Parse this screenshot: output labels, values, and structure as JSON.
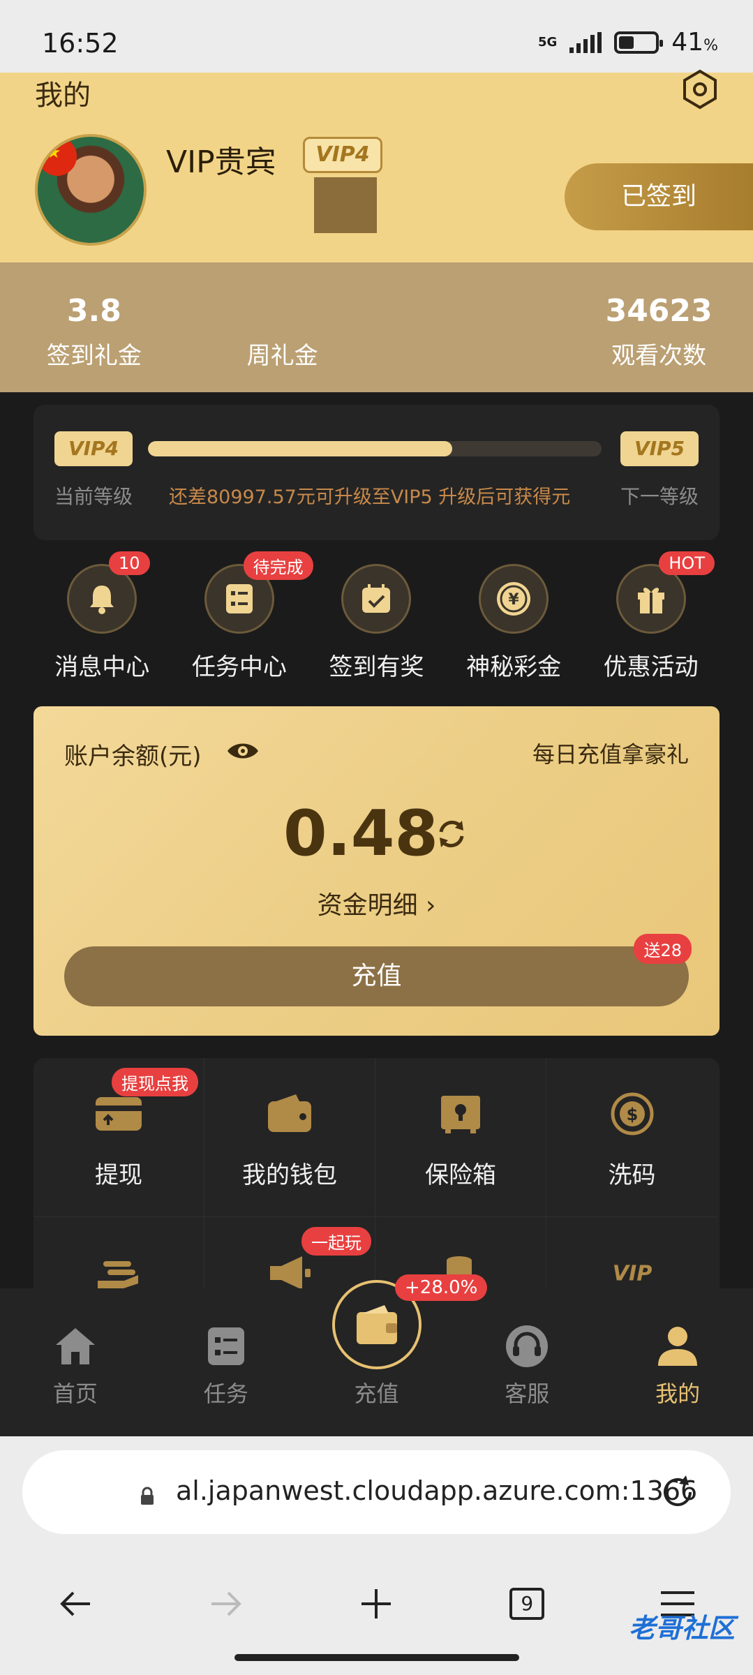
{
  "status_bar": {
    "time": "16:52",
    "network": "5G",
    "battery_value": "41",
    "battery_unit": "%",
    "battery_level": 0.41
  },
  "header": {
    "title": "我的",
    "vip_name": "VIP贵宾",
    "vip_badge": "VIP4",
    "signin_label": "已签到"
  },
  "stats": [
    {
      "value": "3.8",
      "label": "签到礼金"
    },
    {
      "value": "",
      "label": "周礼金"
    },
    {
      "value": "",
      "label": ""
    },
    {
      "value": "34623",
      "label": "观看次数"
    }
  ],
  "vip_progress": {
    "current_level": "VIP4",
    "next_level": "VIP5",
    "current_label": "当前等级",
    "next_label": "下一等级",
    "hint": "还差80997.57元可升级至VIP5 升级后可获得元",
    "progress": 0.67
  },
  "quick_icons": [
    {
      "label": "消息中心",
      "icon": "bell-icon",
      "badge": "10"
    },
    {
      "label": "任务中心",
      "icon": "task-list-icon",
      "badge": "待完成"
    },
    {
      "label": "签到有奖",
      "icon": "calendar-check-icon",
      "badge": ""
    },
    {
      "label": "神秘彩金",
      "icon": "yen-coin-icon",
      "badge": ""
    },
    {
      "label": "优惠活动",
      "icon": "gift-icon",
      "badge": "HOT"
    }
  ],
  "balance": {
    "label": "账户余额(元)",
    "promo": "每日充值拿豪礼",
    "amount": "0.48",
    "detail_link": "资金明细 ›",
    "recharge_label": "充值",
    "recharge_badge": "送28"
  },
  "services": [
    {
      "label": "提现",
      "icon": "card-withdraw-icon",
      "badge": "提现点我"
    },
    {
      "label": "我的钱包",
      "icon": "wallet-icon",
      "badge": ""
    },
    {
      "label": "保险箱",
      "icon": "safe-icon",
      "badge": ""
    },
    {
      "label": "洗码",
      "icon": "dollar-cycle-icon",
      "badge": ""
    },
    {
      "label": "",
      "icon": "hand-coins-icon",
      "badge": ""
    },
    {
      "label": "",
      "icon": "megaphone-icon",
      "badge": "一起玩"
    },
    {
      "label": "",
      "icon": "coins-stack-icon",
      "badge": ""
    },
    {
      "label": "",
      "icon": "vip-text-icon",
      "badge": ""
    }
  ],
  "bottom_nav": {
    "items": [
      {
        "label": "首页",
        "icon": "home-icon"
      },
      {
        "label": "任务",
        "icon": "task-list-icon"
      },
      {
        "label": "充值",
        "icon": "wallet-icon"
      },
      {
        "label": "客服",
        "icon": "headset-icon"
      },
      {
        "label": "我的",
        "icon": "user-icon"
      }
    ],
    "fab_badge": "+28.0%"
  },
  "browser": {
    "url": "al.japanwest.cloudapp.azure.com:1366",
    "tab_count": "9"
  },
  "colors": {
    "gold": "#f2d488",
    "accent": "#e7c172",
    "badge_red": "#e84040",
    "dark_bg": "#1b1b1b"
  }
}
